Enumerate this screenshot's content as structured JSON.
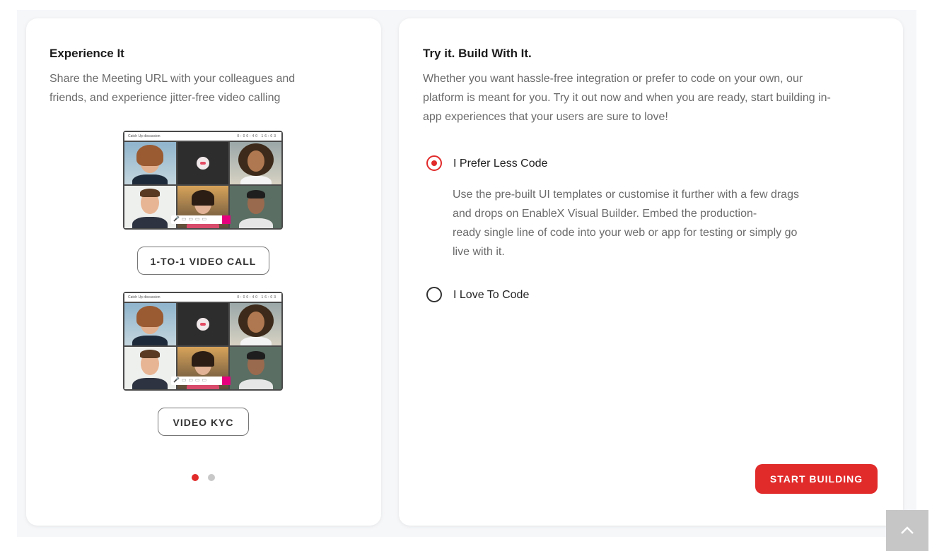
{
  "left_card": {
    "title": "Experience It",
    "description_line1": "Share the Meeting URL with your colleagues and",
    "description_line2": "friends, and experience jitter-free video calling",
    "previews": [
      {
        "header_text": "Catch Up discussion",
        "header_right": "0:00:40  16:03"
      },
      {
        "header_text": "Catch Up discussion",
        "header_right": "0:00:40  16:03"
      }
    ],
    "buttons": [
      "1-TO-1 VIDEO CALL",
      "VIDEO KYC"
    ],
    "pagination": {
      "active_color": "#e12a2a",
      "inactive_color": "#c8c8c8",
      "count": 2,
      "active_index": 0
    }
  },
  "right_card": {
    "title": "Try it. Build With It.",
    "description_line1": "Whether you want hassle-free integration or prefer to code on your own, our",
    "description_line2": "platform is meant for you. Try it out now and when you are ready, start building in-",
    "description_line3": "app experiences that your users are sure to love!",
    "options": [
      {
        "label": "I Prefer Less Code",
        "selected": true,
        "detail_line1": "Use the pre-built UI templates or customise it further with a few drags",
        "detail_line2": "and drops on EnableX Visual Builder. Embed the production-",
        "detail_line3": "ready single line of code into your web or app for testing or simply go",
        "detail_line4": "live with it."
      },
      {
        "label": "I Love To Code",
        "selected": false
      }
    ],
    "cta_label": "START BUILDING"
  },
  "colors": {
    "accent": "#e12a2a",
    "back_to_top_bg": "#c6c6c6"
  },
  "icons": {
    "back_to_top": "chevron-up-icon"
  }
}
